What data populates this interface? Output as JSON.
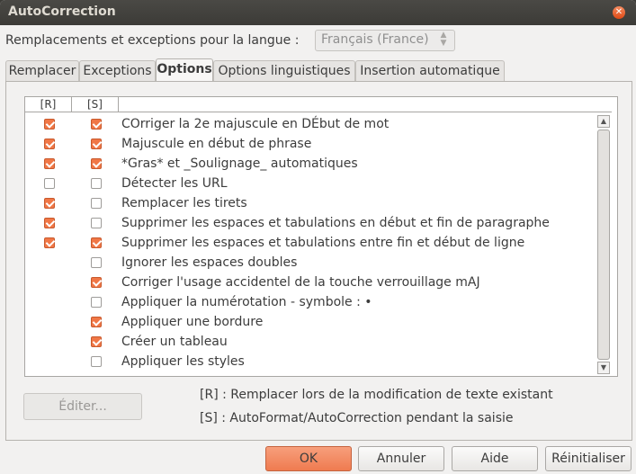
{
  "window": {
    "title": "AutoCorrection",
    "close_glyph": "✕"
  },
  "language": {
    "label": "Remplacements et exceptions pour la langue :",
    "selected": "Français (France)"
  },
  "tabs": [
    {
      "label": "Remplacer",
      "active": false
    },
    {
      "label": "Exceptions",
      "active": false
    },
    {
      "label": "Options",
      "active": true
    },
    {
      "label": "Options linguistiques",
      "active": false
    },
    {
      "label": "Insertion automatique",
      "active": false
    }
  ],
  "options_table": {
    "headers": [
      "[R]",
      "[S]",
      ""
    ],
    "rows": [
      {
        "r": true,
        "s": true,
        "label": "COrriger la 2e majuscule en DÉbut de mot"
      },
      {
        "r": true,
        "s": true,
        "label": "Majuscule en début de phrase"
      },
      {
        "r": true,
        "s": true,
        "label": "*Gras* et _Soulignage_ automatiques"
      },
      {
        "r": false,
        "s": false,
        "label": "Détecter les URL"
      },
      {
        "r": true,
        "s": false,
        "label": "Remplacer les tirets"
      },
      {
        "r": true,
        "s": false,
        "label": "Supprimer les espaces et tabulations en début et fin de paragraphe"
      },
      {
        "r": true,
        "s": true,
        "label": "Supprimer les espaces et tabulations entre fin et début de ligne"
      },
      {
        "r": null,
        "s": false,
        "label": "Ignorer les espaces doubles"
      },
      {
        "r": null,
        "s": true,
        "label": "Corriger l'usage accidentel de la touche verrouillage mAJ"
      },
      {
        "r": null,
        "s": false,
        "label": "Appliquer la numérotation - symbole : •"
      },
      {
        "r": null,
        "s": true,
        "label": "Appliquer une bordure"
      },
      {
        "r": null,
        "s": true,
        "label": "Créer un tableau"
      },
      {
        "r": null,
        "s": false,
        "label": "Appliquer les styles"
      }
    ]
  },
  "edit_button": {
    "label": "Éditer..."
  },
  "legend": {
    "r": "[R] : Remplacer lors de la modification de texte existant",
    "s": "[S] : AutoFormat/AutoCorrection pendant la saisie"
  },
  "footer": {
    "ok": "OK",
    "cancel": "Annuler",
    "help": "Aide",
    "reset": "Réinitialiser"
  },
  "colors": {
    "accent": "#f07746",
    "titlebar": "#3c3b37"
  }
}
